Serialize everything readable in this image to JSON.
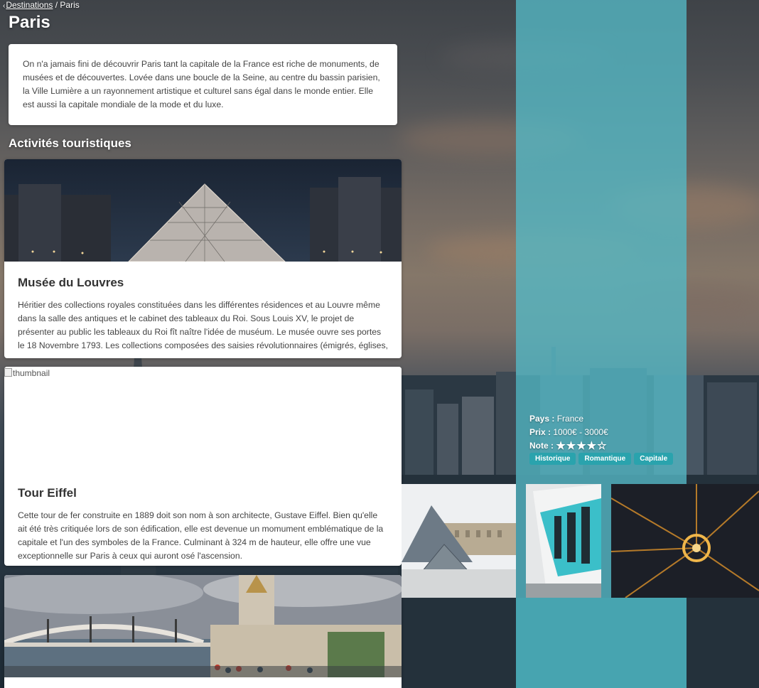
{
  "breadcrumb": {
    "parent": "Destinations",
    "separator": "/",
    "current": "Paris"
  },
  "page": {
    "title": "Paris",
    "intro": "On n'a jamais fini de découvrir Paris tant la capitale de la France est riche de monuments, de musées et de découvertes. Lovée dans une boucle de la Seine, au centre du bassin parisien, la Ville Lumière a un rayonnement artistique et culturel sans égal dans le monde entier. Elle est aussi la capitale mondiale de la mode et du luxe."
  },
  "activities": {
    "heading": "Activités touristiques",
    "items": [
      {
        "title": "Musée du Louvres",
        "text": "Héritier des collections royales constituées dans les différentes résidences et au Louvre même dans la salle des antiques et le cabinet des tableaux du Roi. Sous Louis XV, le projet de présenter au public les tableaux du Roi fît naître l'idée de muséum. Le musée ouvre ses portes le 18 Novembre 1793. Les collections composées des saisies révolutionnaires (émigrés, églises,"
      },
      {
        "title": "Tour Eiffel",
        "image_alt": "thumbnail",
        "text": "Cette tour de fer construite en 1889 doit son nom à son architecte, Gustave Eiffel. Bien qu'elle ait été très critiquée lors de son édification, elle est devenue un momument emblématique de la capitale et l'un des symboles de la France. Culminant à 324 m de hauteur, elle offre une vue exceptionnelle sur Paris à ceux qui auront osé l'ascension."
      },
      {
        "title": ""
      }
    ]
  },
  "info": {
    "country_label": "Pays :",
    "country_value": "France",
    "price_label": "Prix :",
    "price_value": "1000€ - 3000€",
    "rating_label": "Note :",
    "rating": 4,
    "rating_max": 5,
    "stars_text": "★★★★☆",
    "tags": [
      "Historique",
      "Romantique",
      "Capitale"
    ]
  },
  "colors": {
    "teal_column": "#54bac6",
    "tag_bg": "#2aa3ad",
    "card_bg": "#ffffff"
  }
}
